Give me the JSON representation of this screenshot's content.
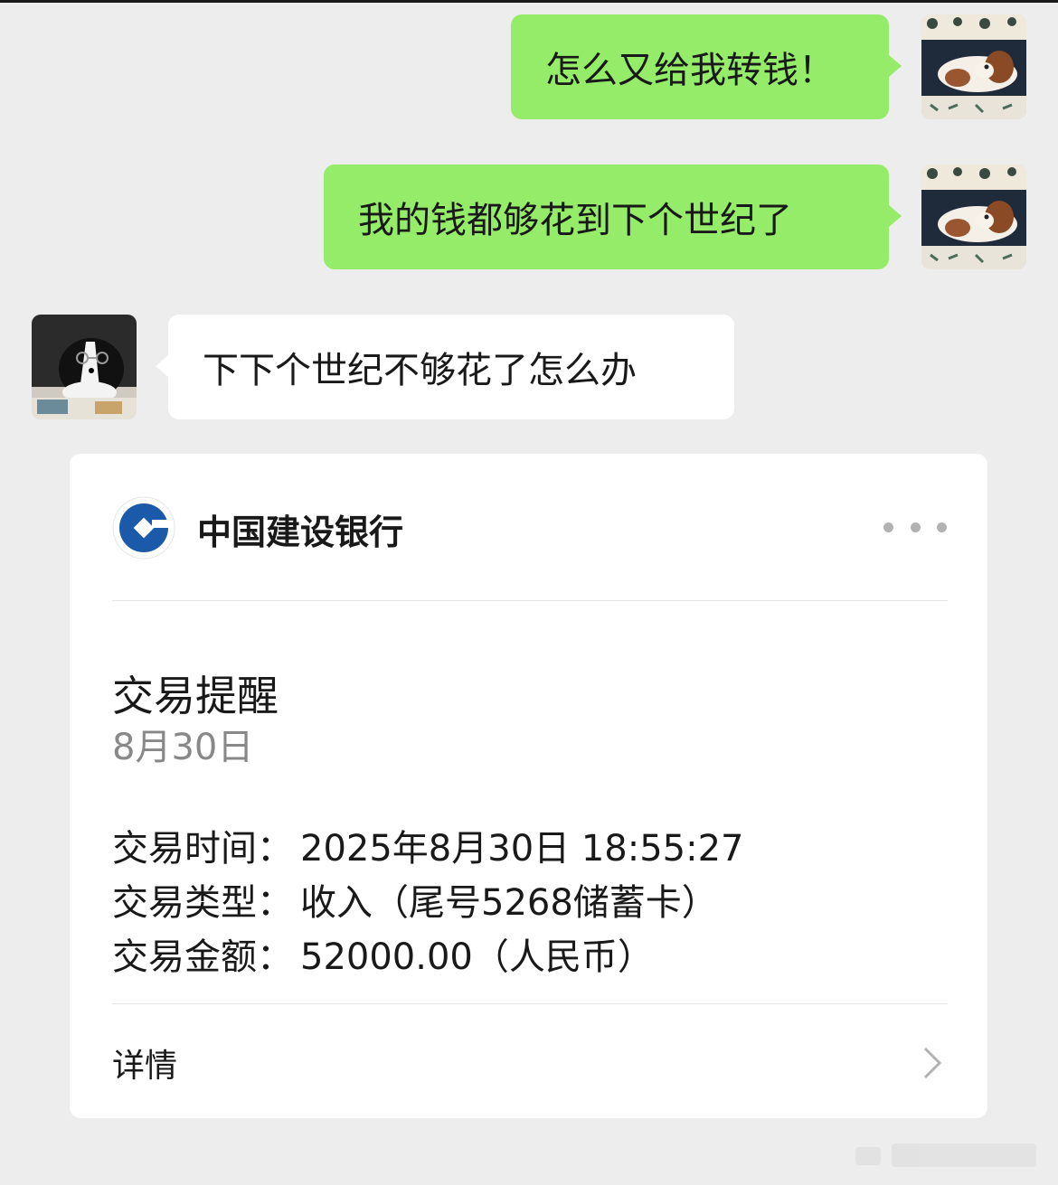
{
  "messages": [
    {
      "from": "me",
      "text": "怎么又给我转钱！"
    },
    {
      "from": "me",
      "text": "我的钱都够花到下个世纪了"
    },
    {
      "from": "other",
      "text": "下下个世纪不够花了怎么办"
    }
  ],
  "card": {
    "bank_name": "中国建设银行",
    "title": "交易提醒",
    "date": "8月30日",
    "fields": [
      {
        "label": "交易时间：",
        "value": "2025年8月30日 18:55:27"
      },
      {
        "label": "交易类型：",
        "value": "收入（尾号5268储蓄卡）"
      },
      {
        "label": "交易金额：",
        "value": "52000.00（人民币）"
      }
    ],
    "details_label": "详情"
  },
  "colors": {
    "background": "#ededed",
    "my_bubble": "#95ec69",
    "other_bubble": "#ffffff",
    "bank_blue": "#1a5aa8"
  },
  "icons": [
    "dog-avatar-icon",
    "border-collie-avatar-icon",
    "ccb-logo-icon",
    "more-icon",
    "chevron-right-icon"
  ]
}
